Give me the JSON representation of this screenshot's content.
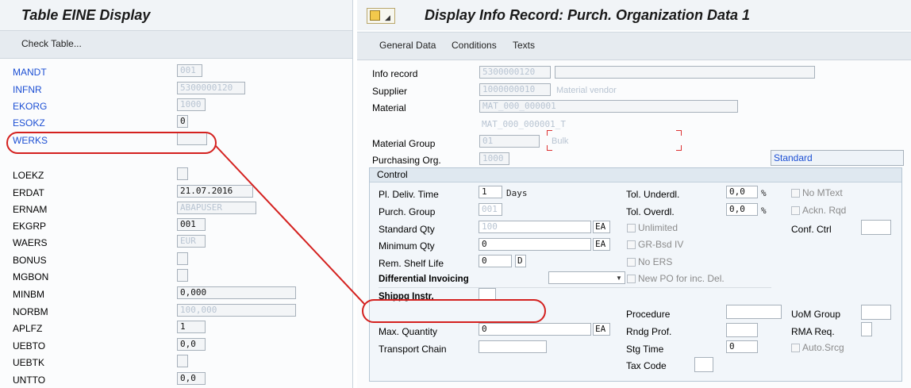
{
  "left": {
    "title": "Table EINE Display",
    "toolbar": {
      "check_table": "Check Table..."
    },
    "fields": [
      {
        "name": "MANDT",
        "value": "001"
      },
      {
        "name": "INFNR",
        "value": "5300000120"
      },
      {
        "name": "EKORG",
        "value": "1000"
      },
      {
        "name": "ESOKZ",
        "value": "0"
      },
      {
        "name": "WERKS",
        "value": ""
      },
      {
        "name": "LOEKZ",
        "value": ""
      },
      {
        "name": "ERDAT",
        "value": "21.07.2016"
      },
      {
        "name": "ERNAM",
        "value": "ABAPUSER"
      },
      {
        "name": "EKGRP",
        "value": "001"
      },
      {
        "name": "WAERS",
        "value": "EUR"
      },
      {
        "name": "BONUS",
        "value": ""
      },
      {
        "name": "MGBON",
        "value": ""
      },
      {
        "name": "MINBM",
        "value": "0,000"
      },
      {
        "name": "NORBM",
        "value": "100,000"
      },
      {
        "name": "APLFZ",
        "value": "1"
      },
      {
        "name": "UEBTO",
        "value": "0,0"
      },
      {
        "name": "UEBTK",
        "value": ""
      },
      {
        "name": "UNTTO",
        "value": "0,0"
      }
    ]
  },
  "right": {
    "title": "Display Info Record: Purch. Organization Data 1",
    "tabs": [
      "General Data",
      "Conditions",
      "Texts"
    ],
    "header": {
      "info_record_label": "Info record",
      "info_record_value": "5300000120",
      "supplier_label": "Supplier",
      "supplier_value": "1000000010",
      "supplier_name": "Material vendor",
      "material_label": "Material",
      "material_value": "MAT_000_000001",
      "material_desc": "MAT_000_000001_T",
      "material_group_label": "Material Group",
      "material_group_value": "01",
      "material_group_desc": "Bulk",
      "purch_org_label": "Purchasing Org.",
      "purch_org_value": "1000",
      "standard": "Standard"
    },
    "control": {
      "title": "Control",
      "pl_deliv_time_label": "Pl. Deliv. Time",
      "pl_deliv_time_value": "1",
      "days": "Days",
      "purch_group_label": "Purch. Group",
      "purch_group_value": "001",
      "standard_qty_label": "Standard Qty",
      "standard_qty_value": "100",
      "standard_qty_unit": "EA",
      "minimum_qty_label": "Minimum Qty",
      "minimum_qty_value": "0",
      "minimum_qty_unit": "EA",
      "rem_shelf_life_label": "Rem. Shelf Life",
      "rem_shelf_life_value": "0",
      "rem_shelf_life_unit": "D",
      "diff_invoicing_label": "Differential Invoicing",
      "shipping_instr_label": "Shippg Instr.",
      "max_quantity_label": "Max. Quantity",
      "max_quantity_value": "0",
      "max_quantity_unit": "EA",
      "transport_chain_label": "Transport Chain",
      "tol_underdl_label": "Tol. Underdl.",
      "tol_underdl_value": "0,0",
      "tol_overdl_label": "Tol. Overdl.",
      "tol_overdl_value": "0,0",
      "percent": "%",
      "unlimited": "Unlimited",
      "gr_bsd_iv": "GR-Bsd IV",
      "no_ers": "No ERS",
      "new_po": "New PO for inc. Del.",
      "no_mtext": "No MText",
      "ackn_rqd": "Ackn. Rqd",
      "conf_ctrl_label": "Conf. Ctrl",
      "procedure_label": "Procedure",
      "rndg_prof_label": "Rndg Prof.",
      "stg_time_label": "Stg Time",
      "stg_time_value": "0",
      "tax_code_label": "Tax Code",
      "uom_group_label": "UoM Group",
      "rma_req_label": "RMA Req.",
      "auto_srcg": "Auto.Srcg"
    }
  },
  "colors": {
    "highlight": "#d4211f",
    "link_blue": "#1c4fd4"
  },
  "icons": [
    "layout-menu-icon",
    "dropdown-arrow-icon"
  ]
}
